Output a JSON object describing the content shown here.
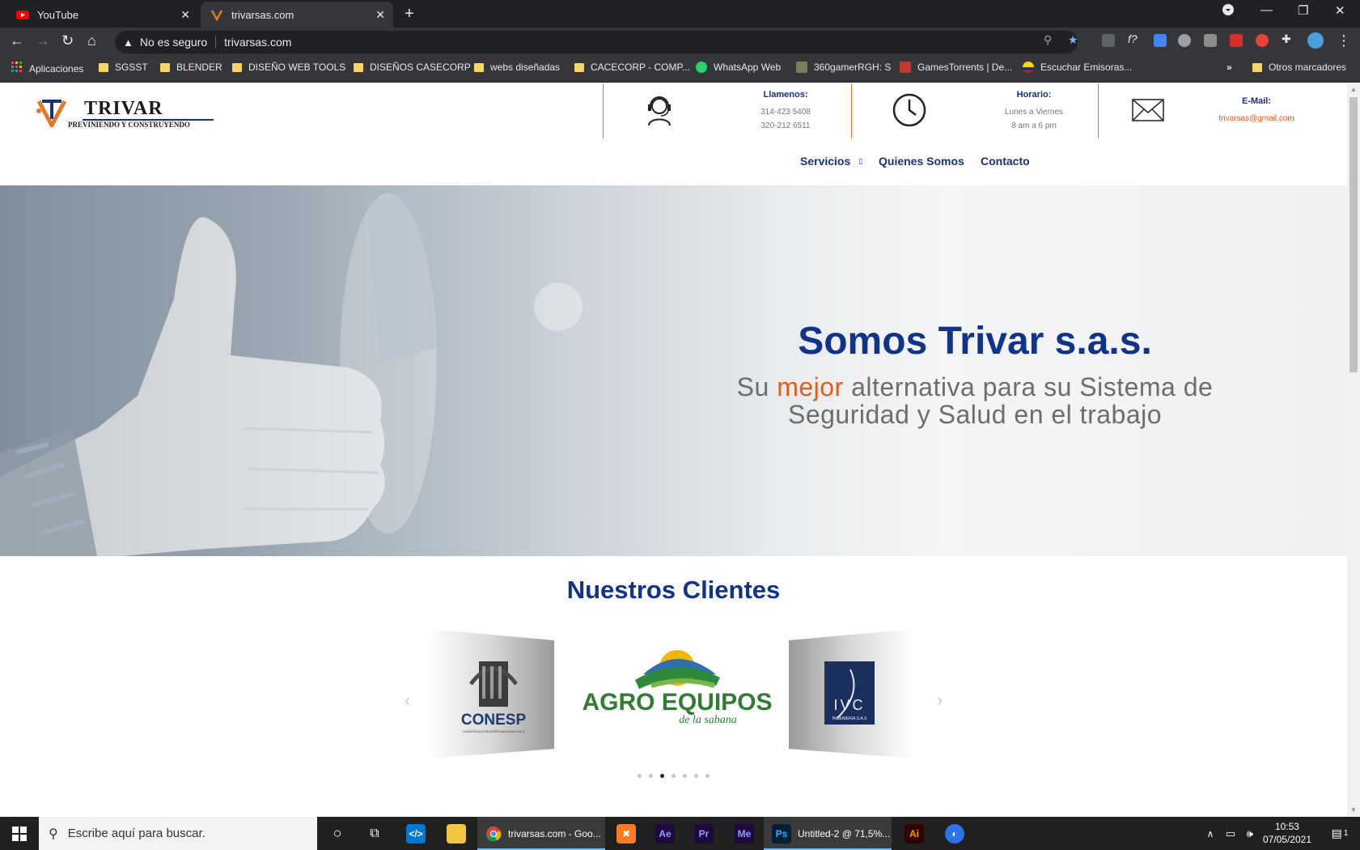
{
  "browser": {
    "tabs": [
      {
        "title": "YouTube"
      },
      {
        "title": "trivarsas.com"
      }
    ],
    "omnibox": {
      "security": "No es seguro",
      "url": "trivarsas.com"
    },
    "bookmarks": [
      {
        "label": "Aplicaciones",
        "icon": "apps-grid-icon"
      },
      {
        "label": "SGSST",
        "icon": "folder-icon"
      },
      {
        "label": "BLENDER",
        "icon": "folder-icon"
      },
      {
        "label": "DISEÑO WEB TOOLS",
        "icon": "folder-icon"
      },
      {
        "label": "DISEÑOS CASECORP",
        "icon": "folder-icon"
      },
      {
        "label": "webs diseñadas",
        "icon": "folder-icon"
      },
      {
        "label": "CACECORP - COMP...",
        "icon": "folder-icon"
      },
      {
        "label": "WhatsApp Web",
        "icon": "whatsapp-icon"
      },
      {
        "label": "360gamerRGH: S",
        "icon": "site-icon"
      },
      {
        "label": "GamesTorrents | De...",
        "icon": "site-icon"
      },
      {
        "label": "Escuchar Emisoras...",
        "icon": "site-icon"
      },
      {
        "label": "»",
        "icon": "overflow-icon"
      },
      {
        "label": "Otros marcadores",
        "icon": "folder-icon"
      }
    ]
  },
  "site": {
    "logo": {
      "name": "TRIVAR",
      "tagline": "PREVINIENDO Y CONSTRUYENDO"
    },
    "contact": {
      "phone_title": "Llamenos:",
      "phone_1": "314-423 5408",
      "phone_2": "320-212 6511",
      "hours_title": "Horario:",
      "hours_1": "Lunes a Viernes",
      "hours_2": "8 am a 6 pm",
      "email_title": "E-Mail:",
      "email": "trivarsas@gmail.com"
    },
    "menu": {
      "servicios": "Servicios",
      "quienes": "Quienes Somos",
      "contacto": "Contacto"
    },
    "hero": {
      "title": "Somos Trivar s.a.s.",
      "sub_before": "Su ",
      "sub_highlight": "mejor",
      "sub_after": " alternativa para su Sistema de Seguridad y Salud en el trabajo"
    },
    "clients": {
      "title": "Nuestros Clientes",
      "logos": [
        {
          "name": "CONESP",
          "caption": "CONSTRUCCION ESPECIALIZADA S.A.S"
        },
        {
          "name": "AGRO EQUIPOS",
          "caption": "de la sabana"
        },
        {
          "name": "IVC",
          "caption": "INGENIERIA S.A.S"
        }
      ],
      "dot_count": 7,
      "active_dot": 3
    }
  },
  "taskbar": {
    "search_placeholder": "Escribe aquí para buscar.",
    "apps": [
      {
        "label": "trivarsas.com - Goo..."
      },
      {
        "label": "Untitled-2 @ 71,5%..."
      }
    ],
    "time": "10:53",
    "date": "07/05/2021",
    "notifications": "1"
  },
  "colors": {
    "brand_blue": "#12338a",
    "accent_orange": "#e05e1e"
  }
}
